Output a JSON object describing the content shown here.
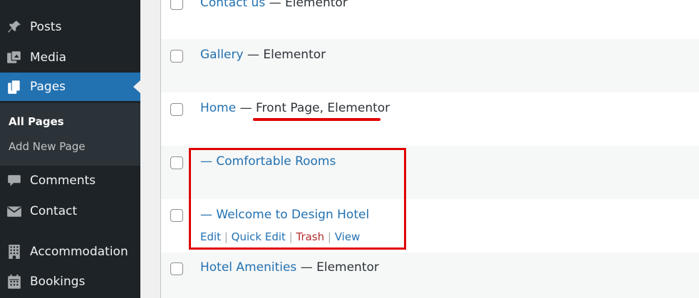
{
  "sidebar": {
    "items": [
      {
        "label": "Posts",
        "icon": "pin-icon"
      },
      {
        "label": "Media",
        "icon": "media-icon"
      },
      {
        "label": "Pages",
        "icon": "pages-icon",
        "current": true
      },
      {
        "label": "Comments",
        "icon": "comments-icon"
      },
      {
        "label": "Contact",
        "icon": "envelope-icon"
      },
      {
        "label": "Accommodation",
        "icon": "building-icon"
      },
      {
        "label": "Bookings",
        "icon": "calendar-icon"
      }
    ],
    "submenu": [
      {
        "label": "All Pages",
        "current": true
      },
      {
        "label": "Add New Page"
      }
    ]
  },
  "pages": {
    "rows": [
      {
        "title": "Contact us",
        "state": " — Elementor"
      },
      {
        "title": "Gallery",
        "state": " — Elementor"
      },
      {
        "title": "Home",
        "sep": " — ",
        "state": "Front Page, Elementor"
      },
      {
        "title": "— Comfortable Rooms",
        "state": ""
      },
      {
        "title": "— Welcome to Design Hotel",
        "state": ""
      },
      {
        "title": "Hotel Amenities",
        "state": " — Elementor"
      }
    ],
    "row_actions": {
      "edit": "Edit",
      "quick_edit": "Quick Edit",
      "trash": "Trash",
      "view": "View",
      "separator": " | "
    }
  },
  "annotations": {
    "highlight_color": "#e00000"
  },
  "colors": {
    "sidebar_bg": "#1d2327",
    "accent": "#2271b1",
    "link": "#2271b1",
    "trash": "#b32d2e"
  }
}
